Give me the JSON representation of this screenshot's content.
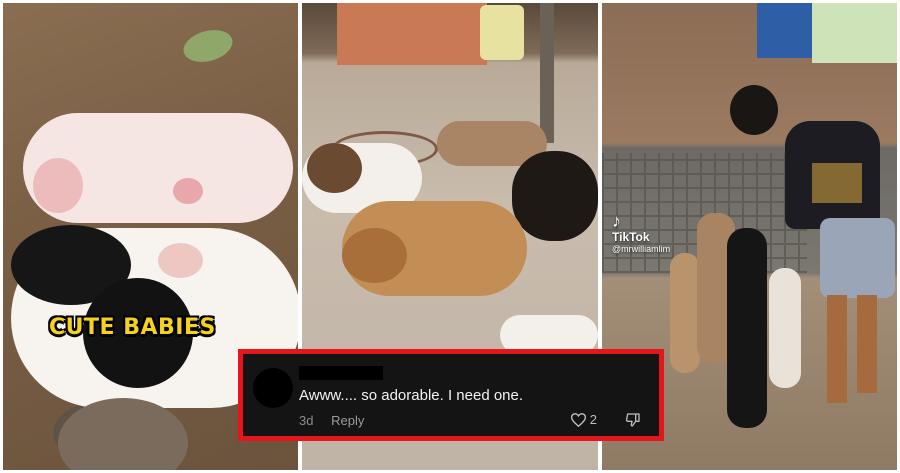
{
  "panels": {
    "left": {
      "caption": "CUTE BABIES"
    },
    "right": {
      "watermark_brand": "TikTok",
      "watermark_handle": "@mrwilliamlim",
      "watermark_logo": "♪"
    }
  },
  "comment": {
    "text": "Awww.... so adorable. I need one.",
    "age": "3d",
    "reply_label": "Reply",
    "like_count": "2"
  },
  "colors": {
    "highlight_border": "#e5161b",
    "caption": "#f7d21c",
    "comment_bg": "#141414"
  },
  "icons": [
    "heart-icon",
    "dislike-icon",
    "tiktok-logo-icon"
  ]
}
